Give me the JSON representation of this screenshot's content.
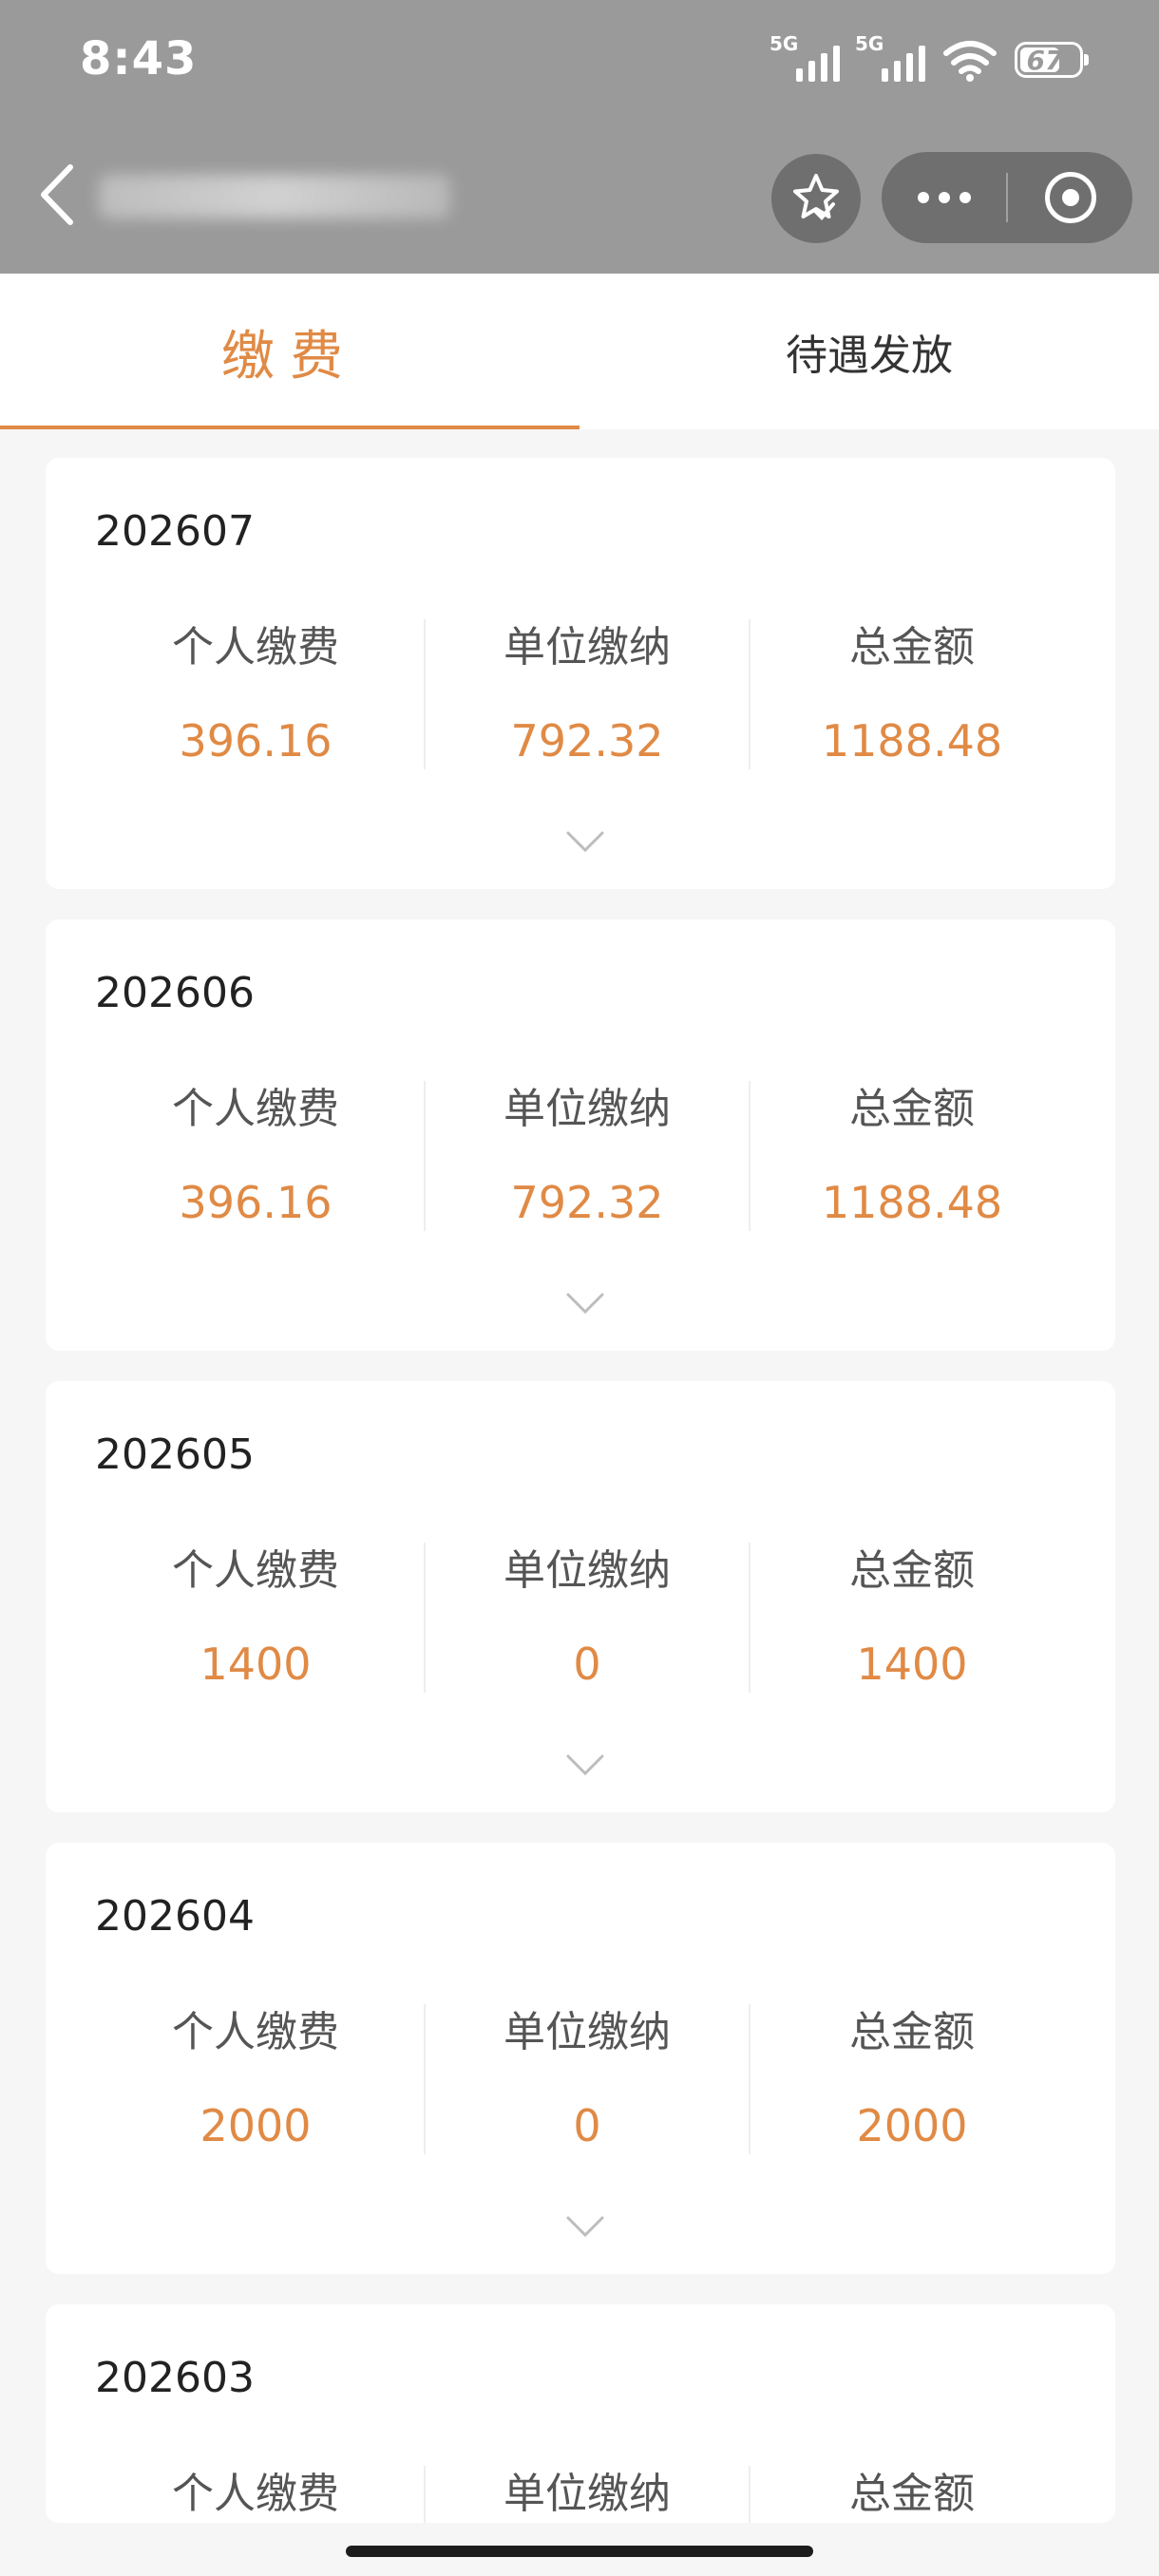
{
  "status_bar": {
    "time": "8:43",
    "sim1": "5G",
    "sim2": "5G",
    "battery": "67"
  },
  "nav": {
    "back_icon": "chevron-left-icon",
    "favorite_icon": "star-icon",
    "more_icon": "more-dots-icon",
    "close_icon": "target-icon"
  },
  "tabs": [
    {
      "label": "缴费",
      "active": true
    },
    {
      "label": "待遇发放",
      "active": false
    }
  ],
  "labels": {
    "personal": "个人缴费",
    "unit": "单位缴纳",
    "total": "总金额"
  },
  "records": [
    {
      "month": "202607",
      "personal": "396.16",
      "unit": "792.32",
      "total": "1188.48"
    },
    {
      "month": "202606",
      "personal": "396.16",
      "unit": "792.32",
      "total": "1188.48"
    },
    {
      "month": "202605",
      "personal": "1400",
      "unit": "0",
      "total": "1400"
    },
    {
      "month": "202604",
      "personal": "2000",
      "unit": "0",
      "total": "2000"
    },
    {
      "month": "202603",
      "personal": "",
      "unit": "",
      "total": ""
    }
  ],
  "colors": {
    "accent": "#e08a45",
    "header_gray": "#9a9a9a",
    "background": "#f6f6f6"
  }
}
